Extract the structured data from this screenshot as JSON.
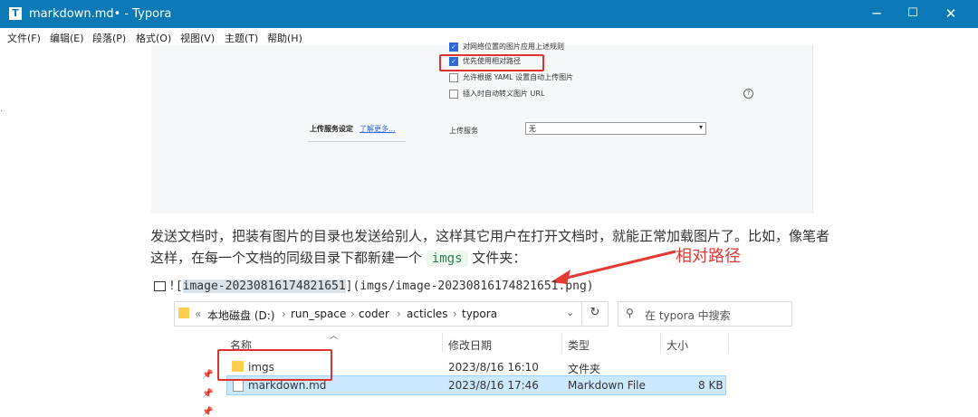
{
  "window": {
    "title": "markdown.md• - Typora",
    "controls": {
      "minimize": "─",
      "maximize": "☐",
      "close": "✕"
    }
  },
  "menu": [
    "文件(F)",
    "编辑(E)",
    "段落(P)",
    "格式(O)",
    "视图(V)",
    "主题(T)",
    "帮助(H)"
  ],
  "settings": {
    "options": [
      {
        "label": "对网络位置的图片应用上述规则",
        "checked": true
      },
      {
        "label": "优先使用相对路径",
        "checked": true
      },
      {
        "label": "允许根据 YAML 设置自动上传图片",
        "checked": false
      },
      {
        "label": "插入时自动转义图片 URL",
        "checked": false
      }
    ],
    "upload_label": "上传服务设定",
    "learn_more": "了解更多...",
    "service_label": "上传服务",
    "service_value": "无",
    "help_icon": "?"
  },
  "paragraph": {
    "line1": "发送文档时，把装有图片的目录也发送给别人，这样其它用户在打开文档时，就能正常加载图片了。比如，像笔者",
    "line2_prefix": "这样，在每一个文档的同级目录下都新建一个",
    "folder_chip": "imgs",
    "line2_suffix": "文件夹："
  },
  "annotation": "相对路径",
  "markdown": {
    "prefix": "![",
    "alt": "image-20230816174821651",
    "suffix": "](imgs/image-20230816174821651.png)"
  },
  "explorer": {
    "breadcrumb": [
      "«",
      "本地磁盘 (D:)",
      "›",
      "run_space",
      "›",
      "coder",
      "›",
      "acticles",
      "›",
      "typora"
    ],
    "search_placeholder": "在 typora 中搜索",
    "columns": [
      "名称",
      "修改日期",
      "类型",
      "大小"
    ],
    "rows": [
      {
        "name": "imgs",
        "date": "2023/8/16 16:10",
        "type": "文件夹",
        "size": "",
        "icon": "folder-icon"
      },
      {
        "name": "markdown.md",
        "date": "2023/8/16 17:46",
        "type": "Markdown File",
        "size": "8 KB",
        "icon": "md-file-icon"
      }
    ]
  },
  "colors": {
    "titlebar": "#0a79b5",
    "annotation": "#e53935",
    "selection": "#cce8ff"
  }
}
